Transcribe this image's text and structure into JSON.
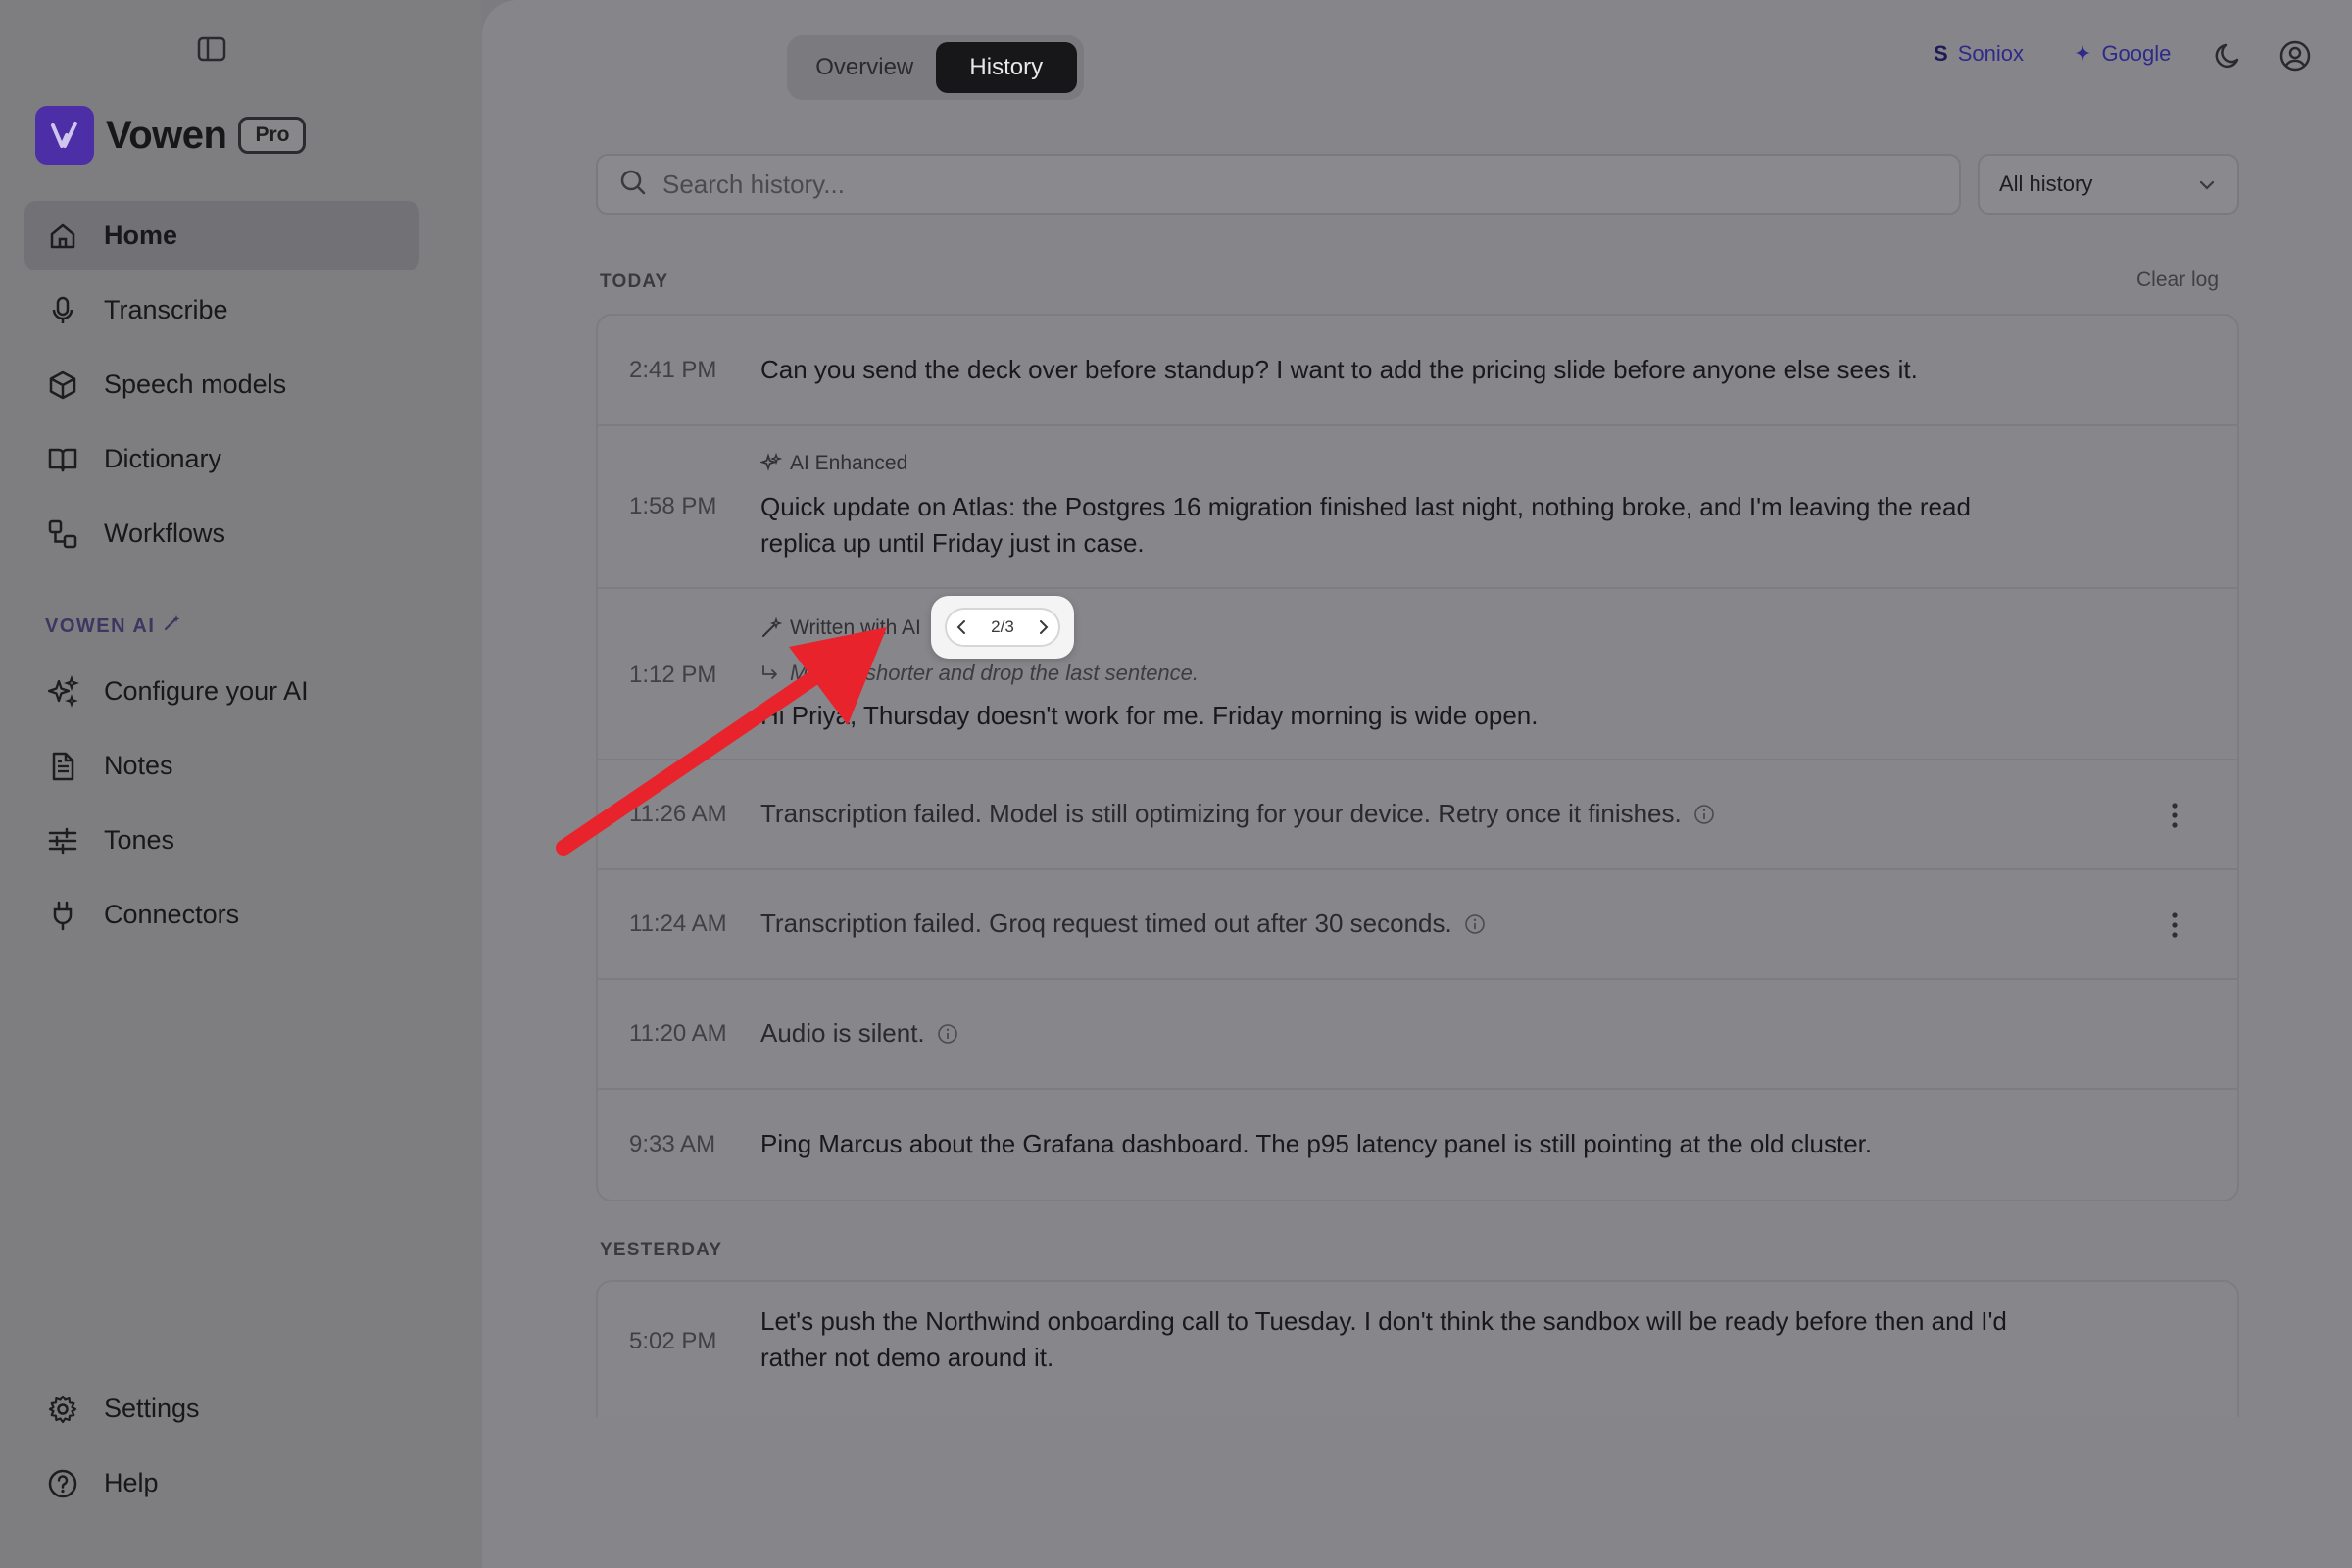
{
  "app": {
    "name": "Vowen",
    "plan_badge": "Pro"
  },
  "sidebar": {
    "primary": [
      {
        "label": "Home",
        "icon": "home-icon",
        "active": true
      },
      {
        "label": "Transcribe",
        "icon": "microphone-icon"
      },
      {
        "label": "Speech models",
        "icon": "cube-icon"
      },
      {
        "label": "Dictionary",
        "icon": "book-icon"
      },
      {
        "label": "Workflows",
        "icon": "workflow-icon"
      }
    ],
    "section_label": "VOWEN AI",
    "ai": [
      {
        "label": "Configure your AI",
        "icon": "sparkles-icon"
      },
      {
        "label": "Notes",
        "icon": "note-icon"
      },
      {
        "label": "Tones",
        "icon": "sliders-icon"
      },
      {
        "label": "Connectors",
        "icon": "plug-icon"
      }
    ],
    "bottom": [
      {
        "label": "Settings",
        "icon": "gear-icon"
      },
      {
        "label": "Help",
        "icon": "help-icon"
      }
    ]
  },
  "header": {
    "tabs": [
      {
        "label": "Overview",
        "active": false
      },
      {
        "label": "History",
        "active": true
      }
    ],
    "providers": [
      {
        "glyph": "S",
        "label": "Soniox"
      },
      {
        "glyph": "✦",
        "label": "Google"
      }
    ]
  },
  "search": {
    "placeholder": "Search history...",
    "value": ""
  },
  "filter": {
    "selected": "All history"
  },
  "history": {
    "clear_label": "Clear log",
    "groups": [
      {
        "label": "TODAY",
        "entries": [
          {
            "time": "2:41 PM",
            "text": "Can you send the deck over before standup? I want to add the pricing slide before anyone else sees it."
          },
          {
            "time": "1:58 PM",
            "tag": "AI Enhanced",
            "text": "Quick update on Atlas: the Postgres 16 migration finished last night, nothing broke, and I'm leaving the read replica up until Friday just in case."
          },
          {
            "time": "1:12 PM",
            "tag": "Written with AI",
            "instruction": "Make it shorter and drop the last sentence.",
            "text": "Hi Priya, Thursday doesn't work for me. Friday morning is wide open.",
            "version": "2/3"
          },
          {
            "time": "11:26 AM",
            "text": "Transcription failed. Model is still optimizing for your device. Retry once it finishes.",
            "failed": true
          },
          {
            "time": "11:24 AM",
            "text": "Transcription failed. Groq request timed out after 30 seconds.",
            "failed": true
          },
          {
            "time": "11:20 AM",
            "text": "Audio is silent.",
            "failed": true
          },
          {
            "time": "9:33 AM",
            "text": "Ping Marcus about the Grafana dashboard. The p95 latency panel is still pointing at the old cluster."
          }
        ]
      },
      {
        "label": "YESTERDAY",
        "entries": [
          {
            "time": "5:02 PM",
            "text": "Let's push the Northwind onboarding call to Tuesday. I don't think the sandbox will be ready before then and I'd rather not demo around it."
          }
        ]
      }
    ]
  },
  "colors": {
    "brand": "#4c2fa6",
    "annotation_arrow": "#e8232c",
    "active_tab": "#171719"
  }
}
